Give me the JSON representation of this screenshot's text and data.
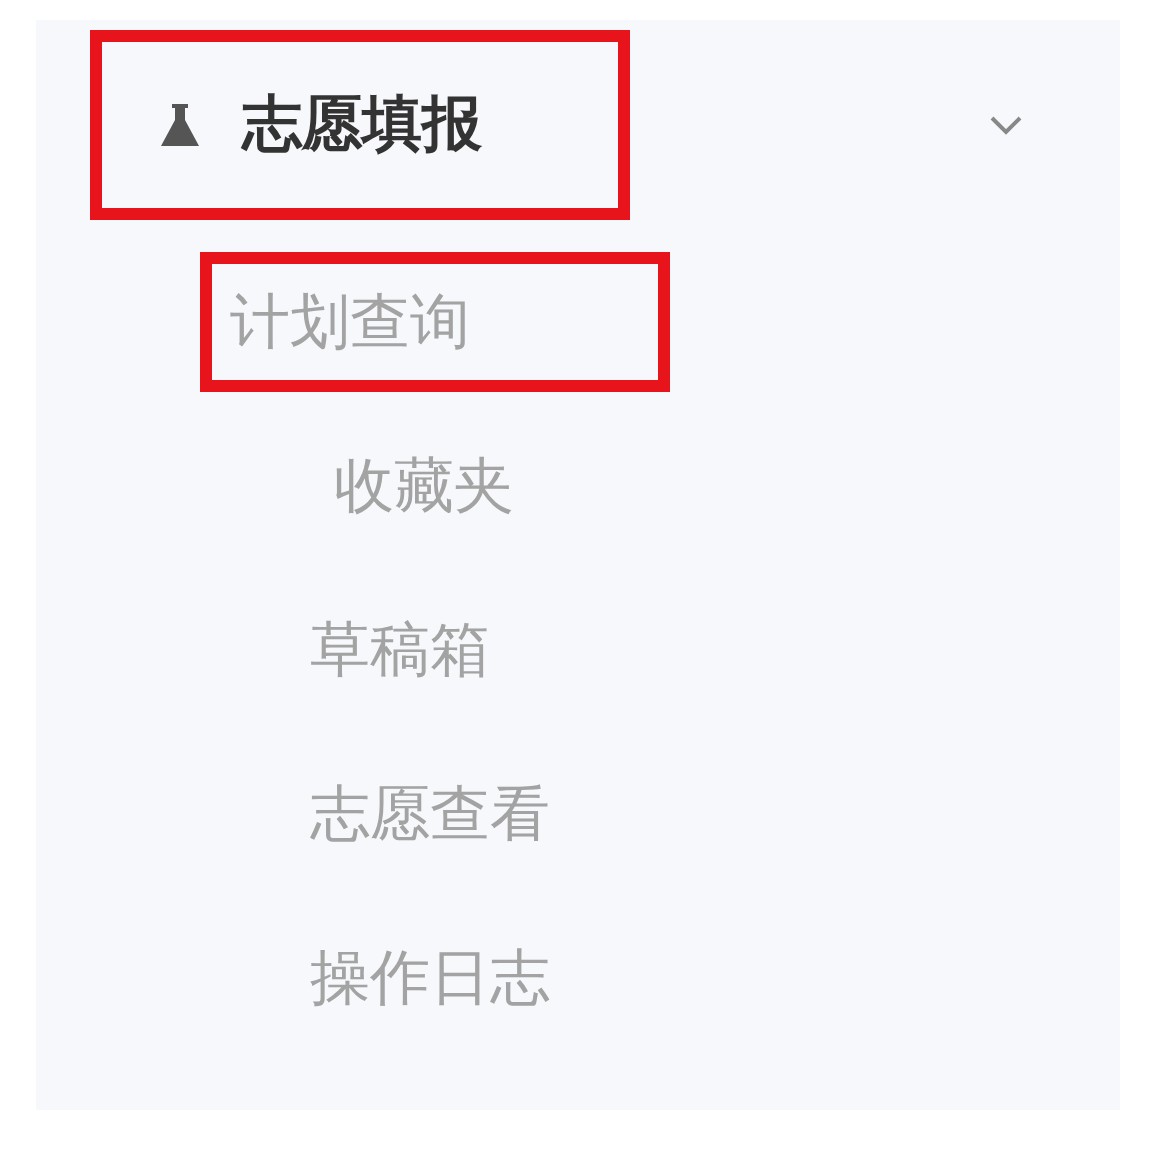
{
  "menu": {
    "title": "志愿填报",
    "expanded": true,
    "highlighted": true,
    "children": [
      {
        "label": "计划查询",
        "highlighted": true
      },
      {
        "label": "收藏夹",
        "highlighted": false
      },
      {
        "label": "草稿箱",
        "highlighted": false
      },
      {
        "label": "志愿查看",
        "highlighted": false
      },
      {
        "label": "操作日志",
        "highlighted": false
      }
    ]
  }
}
